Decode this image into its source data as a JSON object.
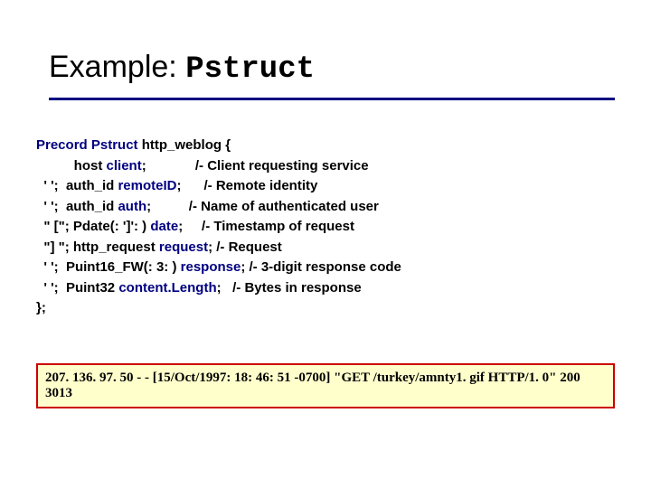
{
  "title": {
    "prefix": "Example: ",
    "mono": "Pstruct"
  },
  "code": {
    "l1_a": "Precord Pstruct",
    "l1_b": " http_weblog {",
    "l2_a": "          host ",
    "l2_b": "client",
    "l2_c": ";             /- Client requesting service",
    "l3_a": "  ' ';  auth_id ",
    "l3_b": "remoteID",
    "l3_c": ";      /- Remote identity",
    "l4_a": "  ' ';  auth_id ",
    "l4_b": "auth",
    "l4_c": ";          /- Name of authenticated user",
    "l5_a": "  \" [\"; Pdate(: ']': ) ",
    "l5_b": "date",
    "l5_c": ";     /- Timestamp of request",
    "l6_a": "  \"] \"; http_request ",
    "l6_b": "request",
    "l6_c": "; /- Request",
    "l7_a": "  ' ';  Puint16_FW(: 3: ) ",
    "l7_b": "response",
    "l7_c": "; /- 3-digit response code",
    "l8_a": "  ' ';  Puint32 ",
    "l8_b": "content.Length",
    "l8_c": ";   /- Bytes in response",
    "l9": "};"
  },
  "log": "207. 136. 97. 50 - - [15/Oct/1997: 18: 46: 51 -0700] \"GET /turkey/amnty1. gif HTTP/1. 0\" 200 3013"
}
